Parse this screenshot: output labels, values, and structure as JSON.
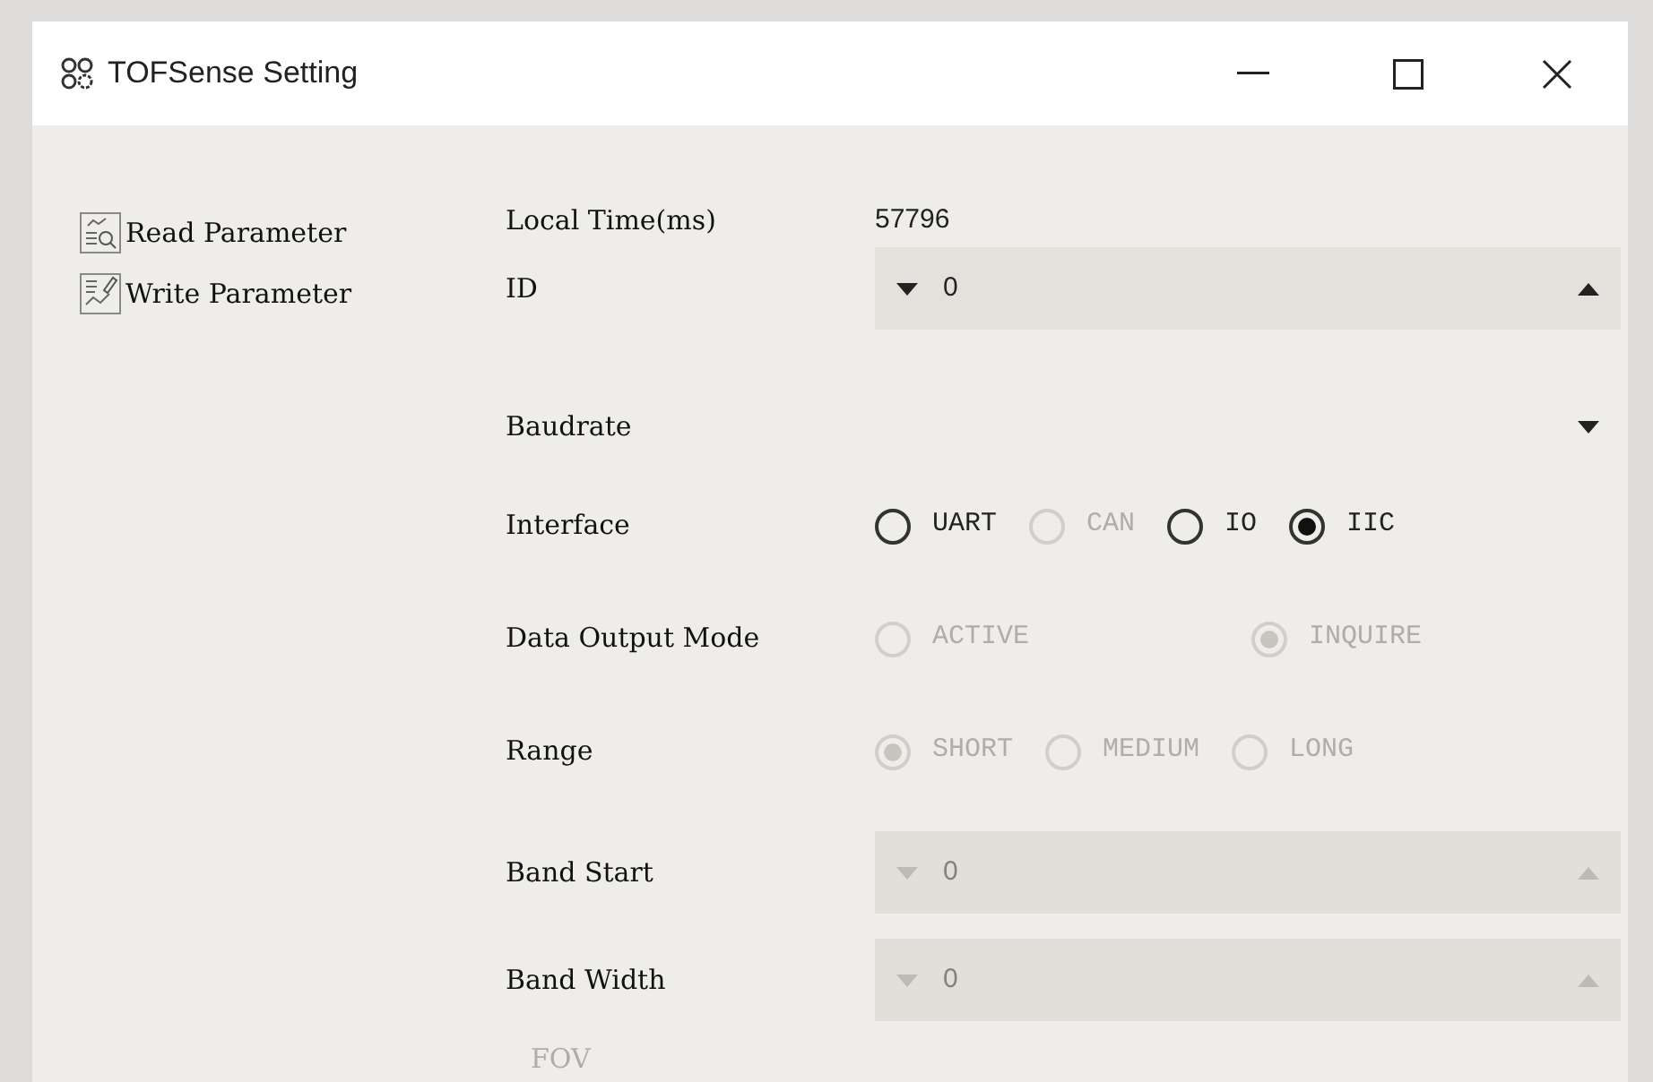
{
  "window": {
    "title": "TOFSense Setting"
  },
  "sidebar": {
    "items": [
      {
        "kind": "read",
        "label": "Read Parameter"
      },
      {
        "kind": "write",
        "label": "Write Parameter"
      }
    ]
  },
  "fields": [
    {
      "kind": "text",
      "label": "Local Time(ms)",
      "value": "57796"
    },
    {
      "kind": "spinner",
      "label": "ID",
      "value": "0",
      "disabled": false
    },
    {
      "kind": "dropdown",
      "label": "Baudrate"
    },
    {
      "kind": "radio",
      "label": "Interface",
      "options": [
        {
          "label": "UART",
          "selected": false,
          "disabled": false
        },
        {
          "label": "CAN",
          "selected": false,
          "disabled": true
        },
        {
          "label": "IO",
          "selected": false,
          "disabled": false
        },
        {
          "label": "IIC",
          "selected": true,
          "disabled": false
        }
      ]
    },
    {
      "kind": "radio",
      "label": "Data Output Mode",
      "options": [
        {
          "label": "ACTIVE",
          "selected": false,
          "disabled": true
        },
        {
          "label": "INQUIRE",
          "selected": true,
          "disabled": true
        }
      ]
    },
    {
      "kind": "radio",
      "label": "Range",
      "options": [
        {
          "label": "SHORT",
          "selected": true,
          "disabled": true
        },
        {
          "label": "MEDIUM",
          "selected": false,
          "disabled": true
        },
        {
          "label": "LONG",
          "selected": false,
          "disabled": true
        }
      ]
    },
    {
      "kind": "spinner",
      "label": "Band Start",
      "value": "0",
      "disabled": true
    },
    {
      "kind": "spinner",
      "label": "Band Width",
      "value": "0",
      "disabled": true
    },
    {
      "kind": "label",
      "label": "FOV",
      "disabled": true
    }
  ]
}
